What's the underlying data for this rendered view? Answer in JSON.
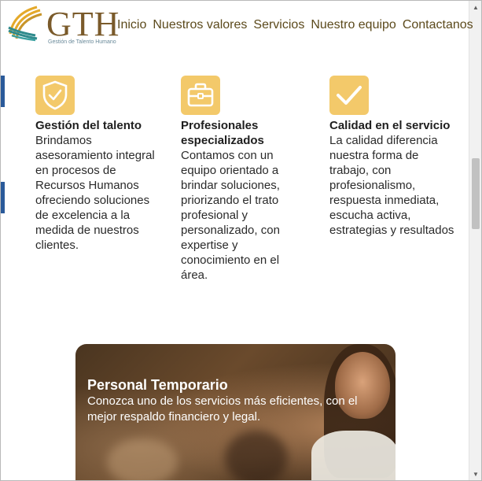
{
  "brand": {
    "name": "GTH",
    "tagline": "Gestión de Talento Humano",
    "logo_colors": [
      "#e4a92a",
      "#2f8a8c",
      "#8a6a3a"
    ]
  },
  "nav": {
    "items": [
      {
        "label": "Inicio"
      },
      {
        "label": "Nuestros valores"
      },
      {
        "label": "Servicios"
      },
      {
        "label": "Nuestro equipo"
      },
      {
        "label": "Contactanos"
      }
    ]
  },
  "features": [
    {
      "icon": "shield-check-icon",
      "title": "Gestión del talento",
      "text": "Brindamos asesoramiento integral en procesos de Recursos Humanos ofreciendo soluciones de excelencia a la medida de nuestros clientes."
    },
    {
      "icon": "briefcase-icon",
      "title": "Profesionales especializados",
      "text": "Contamos con un equipo orientado a brindar soluciones, priorizando el trato profesional y personalizado, con expertise y conocimiento en el área."
    },
    {
      "icon": "checkmark-icon",
      "title": "Calidad en el servicio",
      "text": "La calidad diferencia nuestra forma de trabajo, con profesionalismo, respuesta inmediata, escucha activa, estrategias y resultados"
    }
  ],
  "banner": {
    "title": "Personal Temporario",
    "text": "Conozca uno de los servicios más eficientes, con el mejor respaldo financiero y legal."
  },
  "colors": {
    "accent": "#f3c96a",
    "nav_text": "#5c4a1c",
    "body_text": "#2a2a2a"
  }
}
